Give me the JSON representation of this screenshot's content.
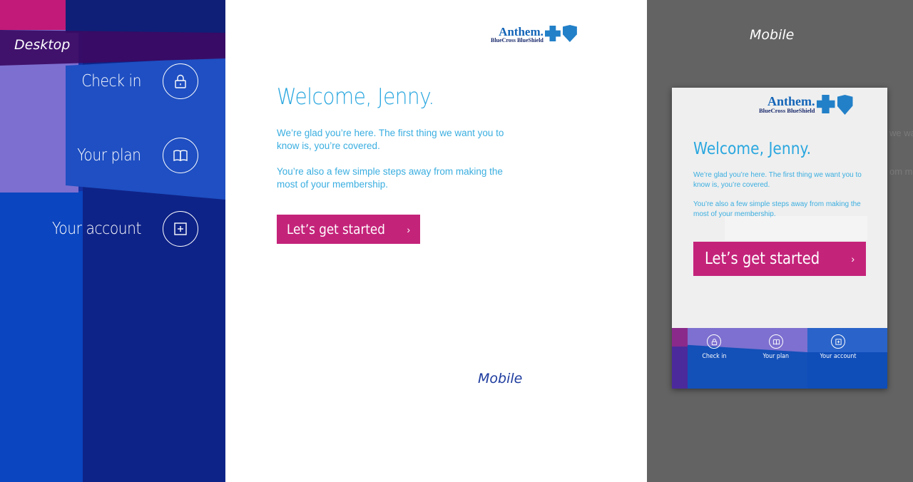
{
  "labels": {
    "desktop": "Desktop",
    "mobile_mid": "Mobile",
    "mobile_right": "Mobile"
  },
  "brand": {
    "name": "Anthem.",
    "sub": "BlueCross BlueShield"
  },
  "nav": {
    "items": [
      {
        "label": "Check in",
        "icon": "lock-icon"
      },
      {
        "label": "Your plan",
        "icon": "book-icon"
      },
      {
        "label": "Your account",
        "icon": "plus-square-icon"
      }
    ]
  },
  "welcome": {
    "title": "Welcome, Jenny.",
    "p1": "We’re glad you’re here. The first thing we want you to know is, you’re covered.",
    "p2": "You’re also a few simple steps away from making the most of your membership.",
    "cta": "Let’s get started",
    "cta_chevron": "›"
  },
  "ghost": {
    "t1": "we wa",
    "t2": "om m"
  },
  "colors": {
    "nav_dark": "#0e2388",
    "nav_blue": "#0d4bc2",
    "nav_purple": "#7d6fd0",
    "magenta": "#c4237a",
    "heading_blue": "#2aa7df",
    "grey_bg": "#636363"
  }
}
